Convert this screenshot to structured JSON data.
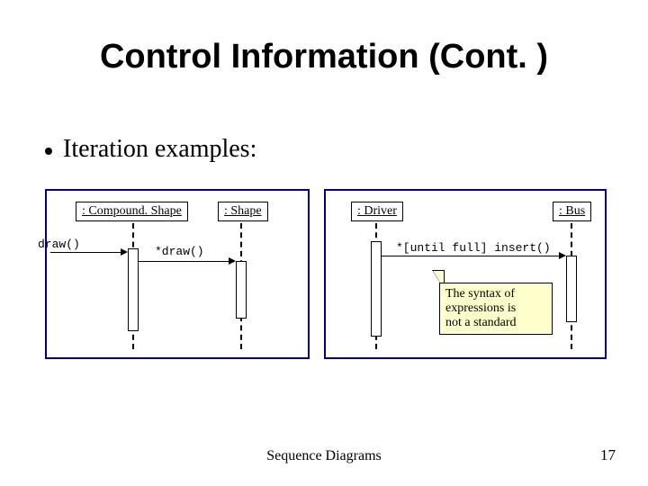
{
  "title": "Control Information (Cont. )",
  "bullet": "Iteration examples:",
  "left": {
    "obj1": ": Compound. Shape",
    "obj2": ": Shape",
    "msg_in": "draw()",
    "msg_internal": "*draw()"
  },
  "right": {
    "obj1": ": Driver",
    "obj2": ": Bus",
    "msg": "*[until full] insert()",
    "note_l1": "The syntax of",
    "note_l2": "expressions is",
    "note_l3": "not a standard"
  },
  "footer": "Sequence Diagrams",
  "page": "17"
}
